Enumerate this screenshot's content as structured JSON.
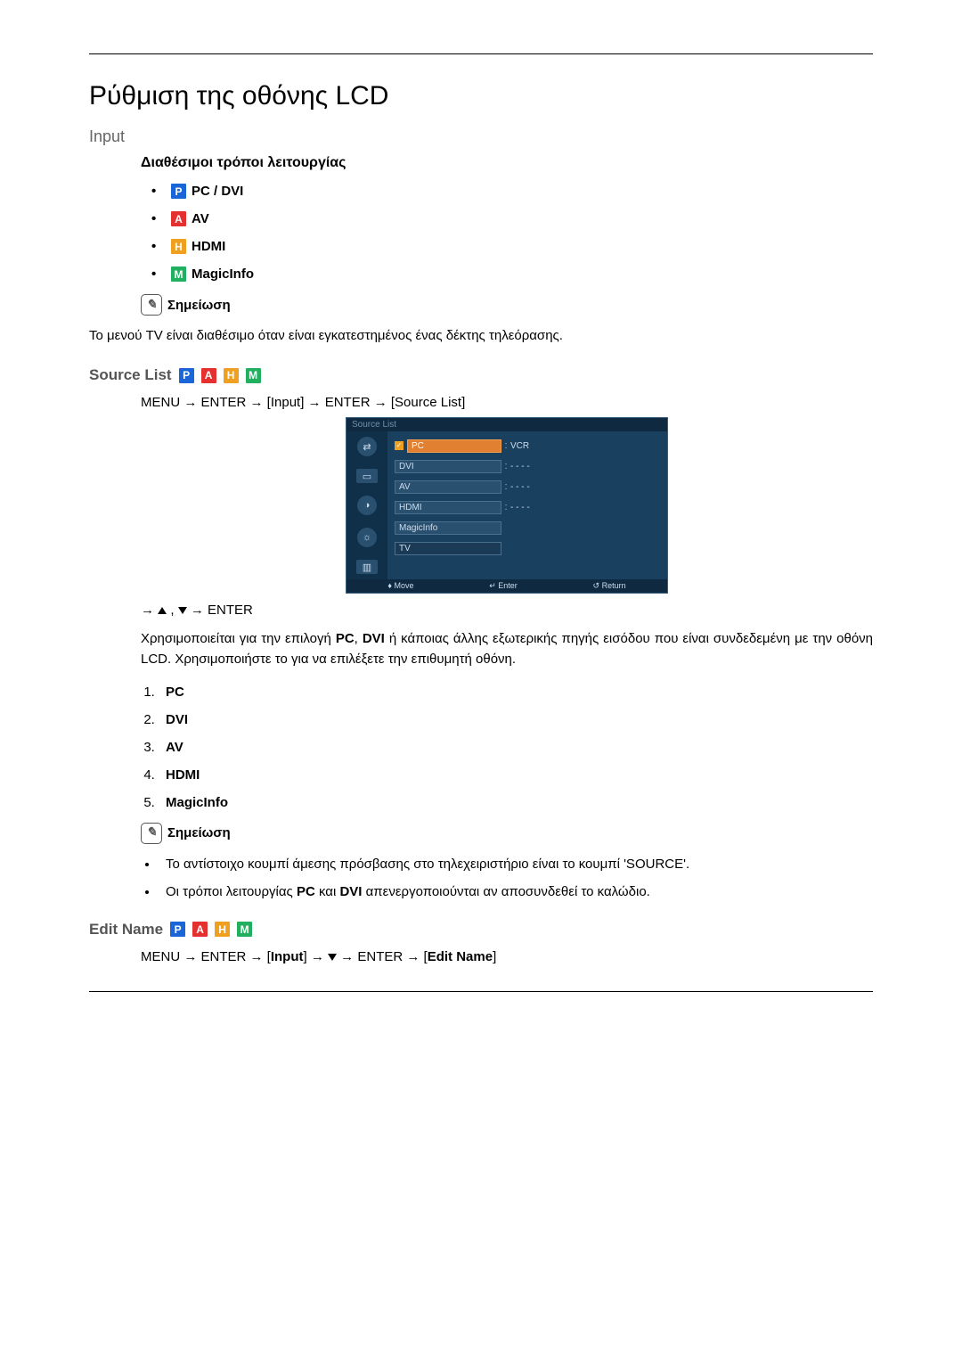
{
  "title": "Ρύθμιση της οθόνης LCD",
  "input_label": "Input",
  "modes_heading": "Διαθέσιμοι τρόποι λειτουργίας",
  "badges": {
    "P": "P",
    "A": "A",
    "H": "H",
    "M": "M"
  },
  "modes": {
    "pc_dvi": "PC / DVI",
    "av": "AV",
    "hdmi": "HDMI",
    "magicinfo": "MagicInfo"
  },
  "note_label": "Σημείωση",
  "note_text_1": "Το μενού TV είναι διαθέσιμο όταν είναι εγκατεστημένος ένας δέκτης τηλεόρασης.",
  "source_list": {
    "heading": "Source List",
    "path": "MENU → ENTER → [Input] → ENTER → [Source List]",
    "nav_after": "→ ▲ , ▼ → ENTER",
    "desc_a": "Χρησιμοποιείται για την επιλογή ",
    "desc_b": "PC",
    "desc_c": ", ",
    "desc_d": "DVI",
    "desc_e": " ή κάποιας άλλης εξωτερικής πηγής εισόδου που είναι συνδεδεμένη με την οθόνη LCD. Χρησιμοποιήστε το για να επιλέξετε την επιθυμητή οθόνη.",
    "items": [
      "PC",
      "DVI",
      "AV",
      "HDMI",
      "MagicInfo"
    ],
    "note2_a": "Το αντίστοιχο κουμπί άμεσης πρόσβασης στο τηλεχειριστήριο είναι το κουμπί 'SOURCE'.",
    "note2_b_1": "Οι τρόποι λειτουργίας ",
    "note2_b_2": "PC",
    "note2_b_3": " και ",
    "note2_b_4": "DVI",
    "note2_b_5": " απενεργοποιούνται αν αποσυνδεθεί το καλώδιο."
  },
  "osd": {
    "header": "Source List",
    "rows": [
      {
        "label": "PC",
        "value": "VCR",
        "orange": true,
        "check": true
      },
      {
        "label": "DVI",
        "value": "- - - -"
      },
      {
        "label": "AV",
        "value": "- - - -"
      },
      {
        "label": "HDMI",
        "value": "- - - -"
      },
      {
        "label": "MagicInfo",
        "value": ""
      },
      {
        "label": "TV",
        "value": ""
      }
    ],
    "footer": {
      "move": "Move",
      "enter": "Enter",
      "return": "Return"
    }
  },
  "edit_name": {
    "heading": "Edit Name",
    "path": "MENU → ENTER → [Input] → ▼ → ENTER → [Edit Name]"
  }
}
